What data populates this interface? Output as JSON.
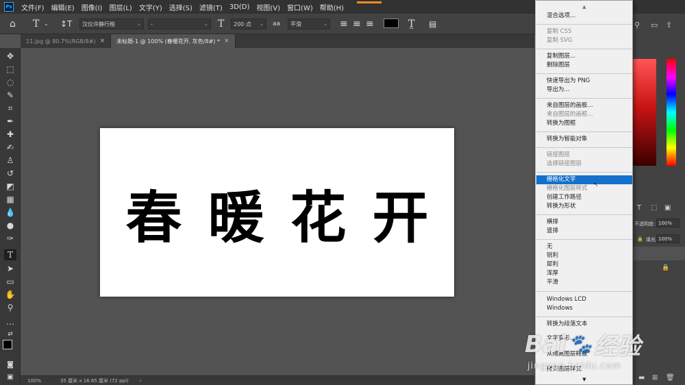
{
  "app": {
    "logo_text": "Ps"
  },
  "menu": [
    "文件(F)",
    "编辑(E)",
    "图像(I)",
    "图层(L)",
    "文字(Y)",
    "选择(S)",
    "滤镜(T)",
    "3D(D)",
    "视图(V)",
    "窗口(W)",
    "帮助(H)"
  ],
  "options": {
    "font_family": "汉仪许静行楷",
    "font_style": "-",
    "font_size": "200 点",
    "antialias_icon": "aa",
    "antialias": "平滑",
    "text_color": "#000000"
  },
  "tabs": [
    {
      "label": "11.jpg @ 80.7%(RGB/8#)",
      "close": "×"
    },
    {
      "label": "未标题-1 @ 100% (春暖花开, 灰色/8#) *",
      "close": "×"
    }
  ],
  "canvas": {
    "text": "春暖花开"
  },
  "status": {
    "zoom": "100%",
    "doc_size": "35 厘米 x 16.65 厘米 (72 ppi)",
    "arrow": "›"
  },
  "right_panel": {
    "opacity_label": "不透明度:",
    "opacity_value": "100%",
    "fill_label": "填充:",
    "fill_value": "100%"
  },
  "context_menu": {
    "items": [
      {
        "label": "混合选项...",
        "disabled": false
      },
      {
        "label": "复制 CSS",
        "disabled": true
      },
      {
        "label": "复制 SVG",
        "disabled": true
      },
      {
        "label": "复制图层...",
        "disabled": false
      },
      {
        "label": "删除图层",
        "disabled": false
      },
      {
        "label": "快速导出为 PNG",
        "disabled": false
      },
      {
        "label": "导出为...",
        "disabled": false
      },
      {
        "label": "来自图层的画板...",
        "disabled": false
      },
      {
        "label": "来自图层的画框...",
        "disabled": true
      },
      {
        "label": "转换为图框",
        "disabled": false
      },
      {
        "label": "转换为智能对象",
        "disabled": false
      },
      {
        "label": "链接图层",
        "disabled": true
      },
      {
        "label": "选择链接图层",
        "disabled": true
      },
      {
        "label": "栅格化文字",
        "disabled": false,
        "highlight": true
      },
      {
        "label": "栅格化图层样式",
        "disabled": true
      },
      {
        "label": "创建工作路径",
        "disabled": false
      },
      {
        "label": "转换为形状",
        "disabled": false
      },
      {
        "label": "横排",
        "disabled": false
      },
      {
        "label": "竖排",
        "disabled": false
      },
      {
        "label": "无",
        "disabled": false
      },
      {
        "label": "锐利",
        "disabled": false
      },
      {
        "label": "犀利",
        "disabled": false
      },
      {
        "label": "浑厚",
        "disabled": false
      },
      {
        "label": "平滑",
        "disabled": false
      },
      {
        "label": "Windows LCD",
        "disabled": false
      },
      {
        "label": "Windows",
        "disabled": false
      },
      {
        "label": "转换为段落文本",
        "disabled": false
      },
      {
        "label": "文字变形...",
        "disabled": false
      },
      {
        "label": "从隔离图层释放",
        "disabled": false
      },
      {
        "label": "拷贝图层样式",
        "disabled": false
      }
    ]
  },
  "watermark": {
    "brand": "Bai",
    "paw": "🐾",
    "brand2": "经验",
    "url": "jingyan.baidu.com"
  },
  "colors": {
    "menu_highlight": "#1470cc",
    "accent": "#31a8ff"
  }
}
